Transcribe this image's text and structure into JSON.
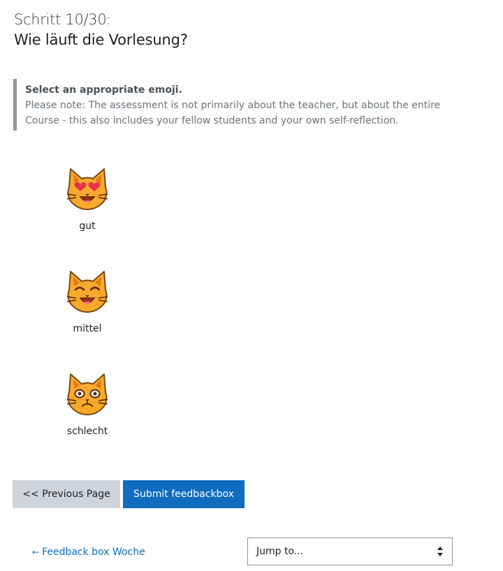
{
  "step": {
    "counter": "Schritt 10/30:",
    "question": "Wie läuft die Vorlesung?"
  },
  "instructions": {
    "title": "Select an appropriate emoji.",
    "note": "Please note: The assessment is not primarily about the teacher, but about the entire Course - this also includes your fellow students and your own self-reflection."
  },
  "options": [
    {
      "label": "gut",
      "icon": "heart-eyes-cat-icon"
    },
    {
      "label": "mittel",
      "icon": "grinning-cat-icon"
    },
    {
      "label": "schlecht",
      "icon": "weary-cat-icon"
    }
  ],
  "buttons": {
    "previous": "<< Previous Page",
    "submit": "Submit feedbackbox"
  },
  "footer": {
    "back_link_arrow": "←",
    "back_link": "Feedback box Woche",
    "jump_placeholder": "Jump to..."
  },
  "colors": {
    "primary": "#0f6cbf",
    "secondary_button": "#ced4da",
    "cat_fill": "#f7a92d",
    "cat_dark": "#e07b16"
  }
}
